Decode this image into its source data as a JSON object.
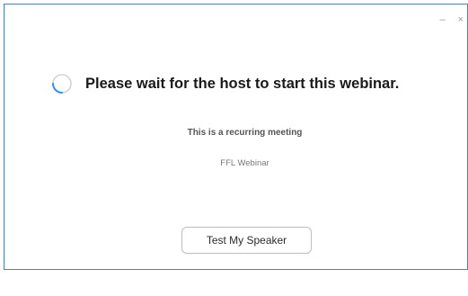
{
  "window": {
    "controls": {
      "minimize_glyph": "–",
      "close_glyph": "×"
    },
    "border_color": "#4a7fc1"
  },
  "status": {
    "icon": "loading-spinner-icon",
    "message": "Please wait for the host to start this webinar.",
    "spinner_accent": "#2d8cff"
  },
  "meeting": {
    "recurring_note": "This is a recurring meeting",
    "name": "FFL Webinar"
  },
  "actions": {
    "test_speaker_label": "Test My Speaker"
  }
}
